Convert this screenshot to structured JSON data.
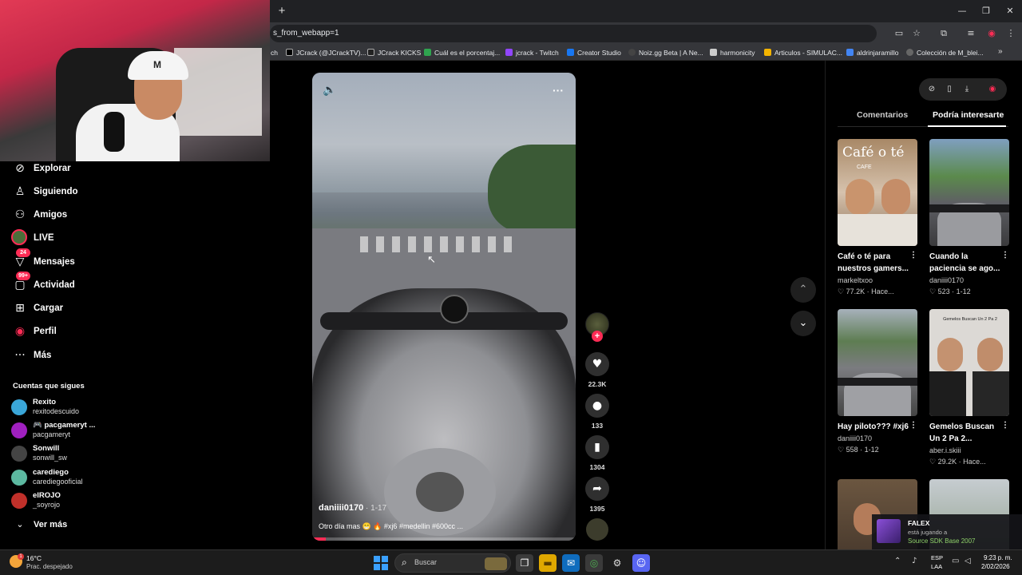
{
  "browser": {
    "address": "s_from_webapp=1",
    "new_tab_icon": "plus-icon",
    "bookmarks": [
      {
        "label": "ch",
        "color": "#555555"
      },
      {
        "label": "JCrack (@JCrackTV)...",
        "color": "#000000"
      },
      {
        "label": "JCrack KICKS",
        "color": "#222222"
      },
      {
        "label": "Cuál es el porcentaj...",
        "color": "#2fa44f"
      },
      {
        "label": "jcrack - Twitch",
        "color": "#9146ff"
      },
      {
        "label": "Creator Studio",
        "color": "#1877f2"
      },
      {
        "label": "Noiz.gg Beta | A Ne...",
        "color": "#444444"
      },
      {
        "label": "harmonicity",
        "color": "#cccccc"
      },
      {
        "label": "Articulos - SIMULAC...",
        "color": "#f4b400"
      },
      {
        "label": "aldrinjaramillo",
        "color": "#4285f4"
      },
      {
        "label": "Colección de M_blei...",
        "color": "#666666"
      }
    ]
  },
  "sidebar": {
    "nav": [
      {
        "label": "Explorar",
        "icon": "compass-icon"
      },
      {
        "label": "Siguiendo",
        "icon": "following-icon"
      },
      {
        "label": "Amigos",
        "icon": "friends-icon"
      },
      {
        "label": "LIVE",
        "icon": "live-icon"
      },
      {
        "label": "Mensajes",
        "icon": "messages-icon",
        "badge": "24"
      },
      {
        "label": "Actividad",
        "icon": "activity-icon",
        "badge": "99+"
      },
      {
        "label": "Cargar",
        "icon": "upload-icon"
      },
      {
        "label": "Perfil",
        "icon": "profile-icon"
      },
      {
        "label": "Más",
        "icon": "more-icon"
      }
    ],
    "following_title": "Cuentas que sigues",
    "following": [
      {
        "name": "Rexito",
        "handle": "rexitodescuido",
        "color": "#3aa6d8"
      },
      {
        "name": "🎮 pacgameryt ...",
        "handle": "pacgameryt",
        "color": "#a020c0"
      },
      {
        "name": "Sonwill",
        "handle": "sonwill_sw",
        "color": "#444444"
      },
      {
        "name": "carediego",
        "handle": "carediegooficial",
        "color": "#5cb8a0"
      },
      {
        "name": "elROJO",
        "handle": "_soyrojo",
        "color": "#c0302a"
      }
    ],
    "see_more": "Ver más"
  },
  "video": {
    "author": "daniiii0170",
    "date": " · 1-17",
    "caption": "Otro día mas 😁 🔥 #xj6 #medellin #600cc ...",
    "progress": 0.05,
    "likes": "22.3K",
    "comments": "133",
    "saves": "1304",
    "shares": "1395"
  },
  "right_panel": {
    "tabs": [
      "Comentarios",
      "Podría interesarte"
    ],
    "active_tab": "Podría interesarte",
    "cards": [
      {
        "title": "Café o té para nuestros gamers...",
        "author": "markeltxoo",
        "stats": "♡ 77.2K · Hace...",
        "thumb_text": "Café o té",
        "thumb_sub": "CAFE",
        "bg": "#b89a7a"
      },
      {
        "title": "Cuando la paciencia se ago...",
        "author": "daniiii0170",
        "stats": "♡ 523 · 1-12",
        "thumb_text": "",
        "thumb_sub": "",
        "bg": "#6f8a6a"
      },
      {
        "title": "Hay piloto??? #xj6",
        "author": "daniiii0170",
        "stats": "♡ 558 · 1-12",
        "thumb_text": "",
        "thumb_sub": "",
        "bg": "#8f9aa0"
      },
      {
        "title": "Gemelos Buscan Un 2 Pa 2...",
        "author": "aber.i.skiii",
        "stats": "♡ 29.2K · Hace...",
        "thumb_text": "",
        "thumb_sub": "Gemelos Buscan Un 2 Pa 2",
        "bg": "#d9d6d2"
      },
      {
        "title": "",
        "author": "",
        "stats": "",
        "thumb_text": "",
        "thumb_sub": "",
        "bg": "#5a4a3c"
      },
      {
        "title": "",
        "author": "",
        "stats": "",
        "thumb_text": "",
        "thumb_sub": "",
        "bg": "#9aa59a"
      }
    ]
  },
  "toast": {
    "name": "FALEX",
    "line": "está jugando a",
    "game": "Source SDK Base 2007"
  },
  "taskbar": {
    "temp": "16°C",
    "weather": "Prac. despejado",
    "weather_badge": "1",
    "search_placeholder": "Buscar",
    "lang1": "ESP",
    "lang2": "LAA",
    "time": "9:23 p. m.",
    "date": "2/02/2026"
  }
}
